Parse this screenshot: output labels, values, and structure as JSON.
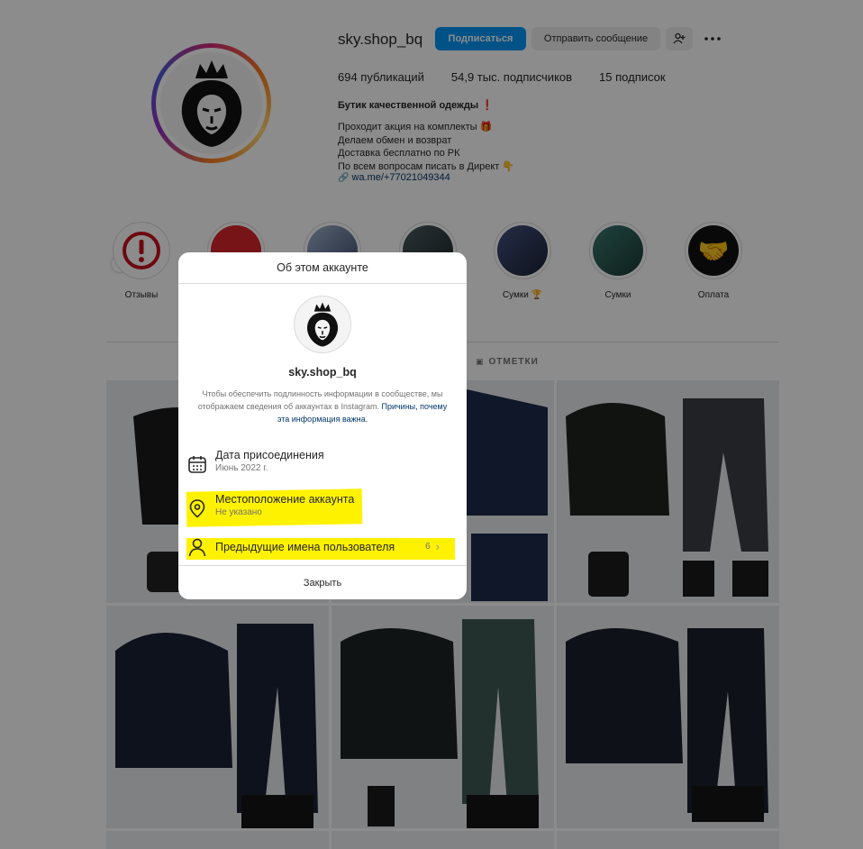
{
  "profile": {
    "username": "sky.shop_bq",
    "follow_label": "Подписаться",
    "message_label": "Отправить сообщение",
    "stats": {
      "posts": "694 публикаций",
      "followers": "54,9 тыс. подписчиков",
      "following": "15 подписок"
    },
    "bio_name": "Бутик качественной одежды ❗",
    "bio_lines": [
      "Проходит акция на комплекты 🎁",
      "Делаем обмен и возврат",
      "Доставка бесплатно по РК",
      "По всем вопросам писать в Директ 👇"
    ],
    "link": "wa.me/+77021049344"
  },
  "highlights": [
    {
      "label": "Отзывы",
      "color": "#c8101e"
    },
    {
      "label": "",
      "color": "#d7262a"
    },
    {
      "label": "",
      "color": "#6a7e9e"
    },
    {
      "label": "",
      "color": "#2b3a3e"
    },
    {
      "label": "Сумки 🏆",
      "color": "#2a3350"
    },
    {
      "label": "Сумки",
      "color": "#2f5d55"
    },
    {
      "label": "Оплата",
      "color": "#1a1a1a"
    }
  ],
  "tabs": {
    "tagged": "ОТМЕТКИ"
  },
  "modal": {
    "title": "Об этом аккаунте",
    "username": "sky.shop_bq",
    "description": "Чтобы обеспечить подлинность информации в сообществе, мы отображаем сведения об аккаунтах в Instagram.",
    "why_link": "Причины, почему эта информация важна.",
    "joined_label": "Дата присоединения",
    "joined_value": "Июнь 2022 г.",
    "location_label": "Местоположение аккаунта",
    "location_value": "Не указано",
    "former_names_label": "Предыдущие имена пользователя",
    "former_names_count": "6",
    "close_label": "Закрыть",
    "highlight_color": "#fff200"
  },
  "colors": {
    "accent": "#0095f6",
    "overlay": "rgba(0,0,0,0.45)"
  }
}
